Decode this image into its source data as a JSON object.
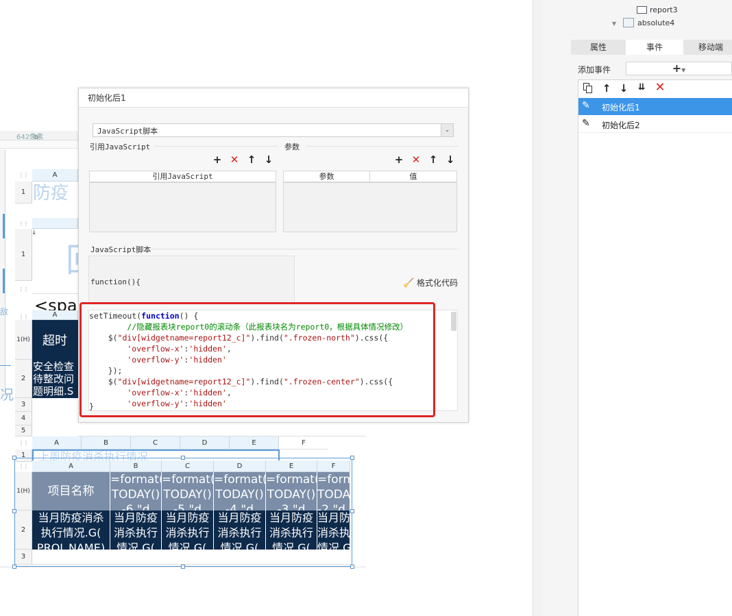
{
  "background_report": {
    "ruler_col_b": "B",
    "ruler_px_label": "642像素",
    "grid1": {
      "col_a": "A",
      "row_1": "1",
      "cell_text": "防疫"
    },
    "grid2": {
      "row_1": "1",
      "big_char": "回",
      "code_fragment": "<spa"
    },
    "grid3": {
      "col_a": "A",
      "row_1h": "1(H)",
      "row_2": "2",
      "row_3": "3",
      "row_4": "4",
      "row_5": "5",
      "cell_header": "超时",
      "cell_body": "安全检查\n待整改问\n题明细.S"
    },
    "side_fragments": {
      "kuang": "况",
      "dui": "敌"
    },
    "grid4": {
      "cols": [
        "A",
        "B",
        "C",
        "D",
        "E",
        "F"
      ],
      "row_1": "1",
      "cell_text": "上周防疫消杀执行情况"
    },
    "grid5": {
      "cols": [
        "A",
        "B",
        "C",
        "D",
        "E",
        "F"
      ],
      "row_1h": "1(H)",
      "row_2": "2",
      "row_3": "3",
      "header_first": "项目名称",
      "header_formula": "=format(\nTODAY()\n",
      "header_formula_tails": [
        "-6,\"d",
        "-5,\"d",
        "-4,\"d",
        "-3,\"d",
        "-2,\"d"
      ],
      "body_first": "当月防疫消杀\n执行情况.G(\nPROJ_NAME)",
      "body_other": "当月防疫\n消杀执行\n情况.G("
    }
  },
  "right_panel": {
    "tree": [
      {
        "label": "report3"
      },
      {
        "label": "absolute4"
      }
    ],
    "tabs": [
      "属性",
      "事件",
      "移动端"
    ],
    "active_tab": "事件",
    "add_event_label": "添加事件",
    "add_event_button": "+",
    "events": [
      {
        "label": "初始化后1",
        "selected": true
      },
      {
        "label": "初始化后2",
        "selected": false
      }
    ],
    "accent_color": "#3d95e8"
  },
  "dialog": {
    "title": "初始化后1",
    "script_type": "JavaScript脚本",
    "ref_js_label": "引用JavaScript",
    "ref_js_column": "引用JavaScript",
    "params_label": "参数",
    "params_columns": [
      "参数",
      "值"
    ],
    "js_script_label": "JavaScript脚本",
    "function_header": "function(){",
    "format_code_label": "格式化代码",
    "code_lines": [
      [
        {
          "t": "pr",
          "v": "setTimeout("
        },
        {
          "t": "kw",
          "v": "function"
        },
        {
          "t": "pr",
          "v": "() {"
        }
      ],
      [
        {
          "t": "cm",
          "v": "        //隐藏报表块report0的滚动条（此报表块名为report0，根据具体情况修改）"
        }
      ],
      [
        {
          "t": "pr",
          "v": "    $("
        },
        {
          "t": "st",
          "v": "\"div[widgetname=report12_c]\""
        },
        {
          "t": "pr",
          "v": ").find("
        },
        {
          "t": "st",
          "v": "\".frozen-north\""
        },
        {
          "t": "pr",
          "v": ").css({"
        }
      ],
      [
        {
          "t": "st",
          "v": "        'overflow-x'"
        },
        {
          "t": "pr",
          "v": ":"
        },
        {
          "t": "st",
          "v": "'hidden'"
        },
        {
          "t": "pr",
          "v": ","
        }
      ],
      [
        {
          "t": "st",
          "v": "        'overflow-y'"
        },
        {
          "t": "pr",
          "v": ":"
        },
        {
          "t": "st",
          "v": "'hidden'"
        }
      ],
      [
        {
          "t": "pr",
          "v": "    });"
        }
      ],
      [
        {
          "t": "pr",
          "v": "    $("
        },
        {
          "t": "st",
          "v": "\"div[widgetname=report12_c]\""
        },
        {
          "t": "pr",
          "v": ").find("
        },
        {
          "t": "st",
          "v": "\".frozen-center\""
        },
        {
          "t": "pr",
          "v": ").css({"
        }
      ],
      [
        {
          "t": "st",
          "v": "        'overflow-x'"
        },
        {
          "t": "pr",
          "v": ":"
        },
        {
          "t": "st",
          "v": "'hidden'"
        },
        {
          "t": "pr",
          "v": ","
        }
      ],
      [
        {
          "t": "st",
          "v": "        'overflow-y'"
        },
        {
          "t": "pr",
          "v": ":"
        },
        {
          "t": "st",
          "v": "'hidden'"
        }
      ]
    ],
    "closing_brace": "}",
    "highlight_color": "#e02424"
  }
}
